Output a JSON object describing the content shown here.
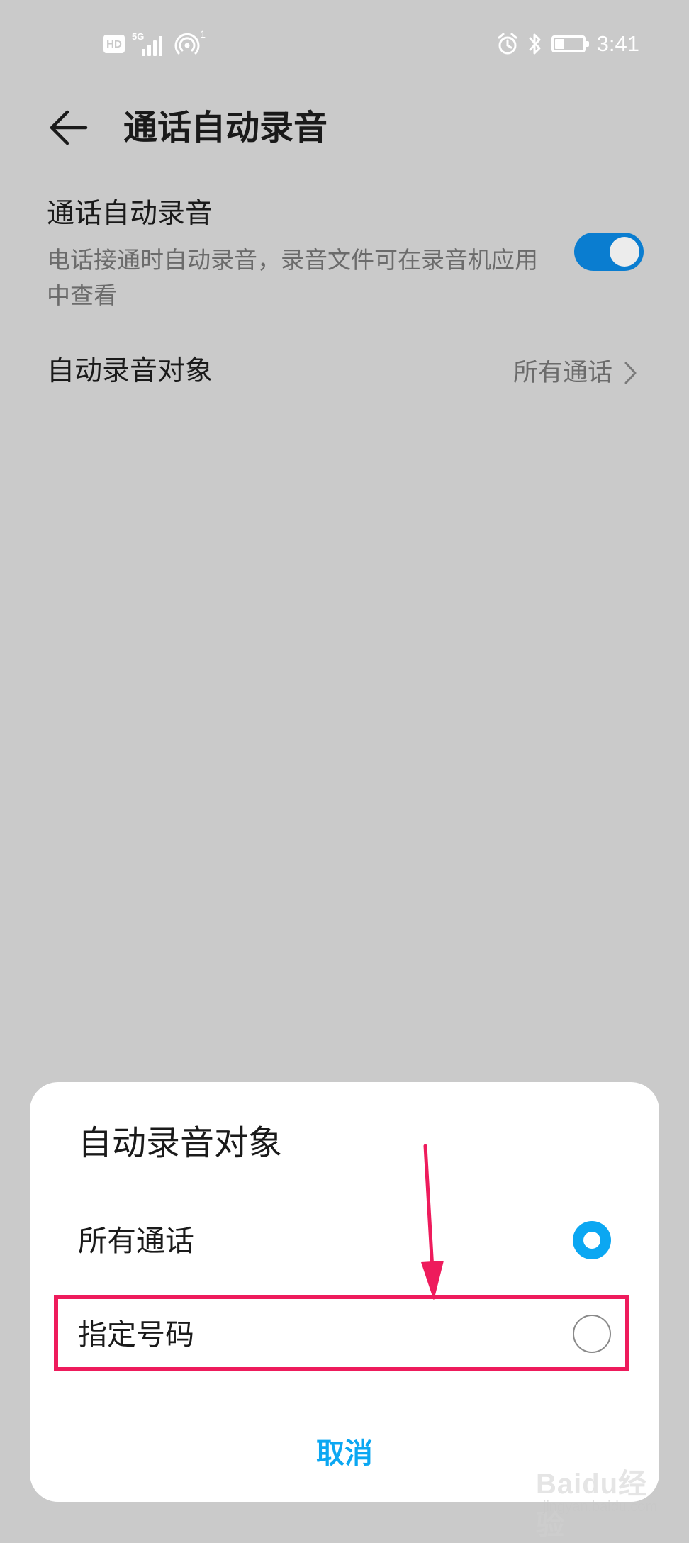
{
  "status_bar": {
    "hd_label": "HD",
    "network_label": "5G",
    "hotspot_count": "1",
    "time": "3:41",
    "battery_level": 0.35,
    "icons": [
      "hd-icon",
      "signal-icon",
      "hotspot-icon",
      "alarm-icon",
      "bluetooth-icon",
      "battery-icon"
    ]
  },
  "header": {
    "back_icon": "arrow-left-icon",
    "title": "通话自动录音"
  },
  "settings": {
    "auto_record": {
      "title": "通话自动录音",
      "description": "电话接通时自动录音，录音文件可在录音机应用中查看",
      "enabled": true
    },
    "record_target": {
      "label": "自动录音对象",
      "value": "所有通话",
      "chevron_icon": "chevron-right-icon"
    }
  },
  "dialog": {
    "title": "自动录音对象",
    "options": [
      {
        "label": "所有通话",
        "selected": true
      },
      {
        "label": "指定号码",
        "selected": false
      }
    ],
    "cancel_label": "取消"
  },
  "colors": {
    "background": "#cacaca",
    "accent": "#0ba7f2",
    "toggle_on": "#0a7dd0",
    "annotation": "#ee1b5c"
  },
  "watermark": {
    "brand": "Baidu经验",
    "url": "jingyan.baidu.com"
  }
}
